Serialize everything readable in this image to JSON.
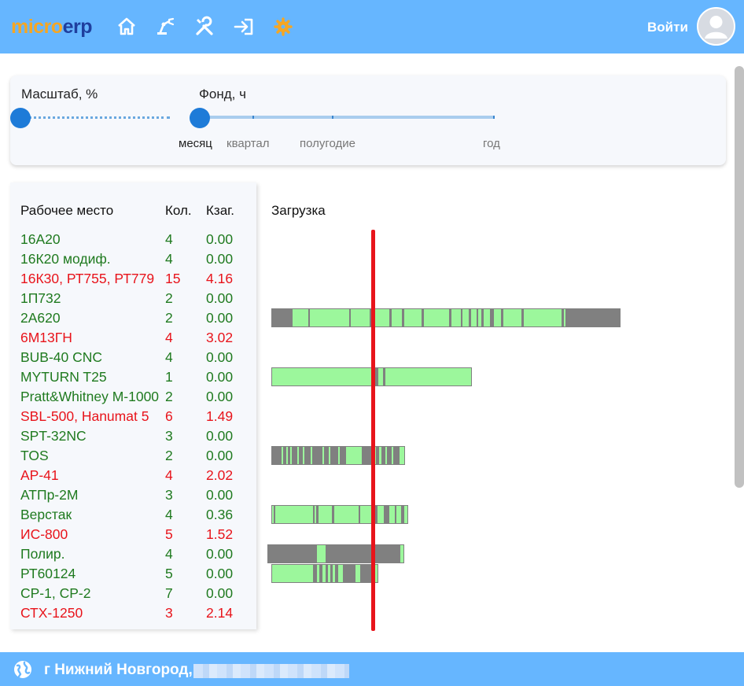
{
  "header": {
    "logo_part1": "micro",
    "logo_part2": "erp",
    "login_label": "Войти",
    "colors": {
      "bar": "#66b6ff",
      "logo1": "#f5a623",
      "logo2": "#1f3f9e"
    }
  },
  "settings": {
    "scale_label": "Масштаб, %",
    "fund_label": "Фонд, ч",
    "fund_ticks": [
      "месяц",
      "квартал",
      "полугодие",
      "год"
    ],
    "fund_selected": "месяц"
  },
  "table": {
    "headers": {
      "workplace": "Рабочее место",
      "qty": "Кол.",
      "coef": "Кзаг."
    },
    "rows": [
      {
        "name": "16А20",
        "qty": "4",
        "coef": "0.00",
        "status": "ok"
      },
      {
        "name": "16К20 модиф.",
        "qty": "4",
        "coef": "0.00",
        "status": "ok"
      },
      {
        "name": "16К30, РТ755, РТ779",
        "qty": "15",
        "coef": "4.16",
        "status": "over"
      },
      {
        "name": "1П732",
        "qty": "2",
        "coef": "0.00",
        "status": "ok"
      },
      {
        "name": "2А620",
        "qty": "2",
        "coef": "0.00",
        "status": "ok"
      },
      {
        "name": "6М13ГН",
        "qty": "4",
        "coef": "3.02",
        "status": "over"
      },
      {
        "name": "BUB-40 CNC",
        "qty": "4",
        "coef": "0.00",
        "status": "ok"
      },
      {
        "name": "MYTURN T25",
        "qty": "1",
        "coef": "0.00",
        "status": "ok"
      },
      {
        "name": "Pratt&Whitney M-1000",
        "qty": "2",
        "coef": "0.00",
        "status": "ok"
      },
      {
        "name": "SBL-500, Hanumat 5",
        "qty": "6",
        "coef": "1.49",
        "status": "over"
      },
      {
        "name": "SPT-32NC",
        "qty": "3",
        "coef": "0.00",
        "status": "ok"
      },
      {
        "name": "TOS",
        "qty": "2",
        "coef": "0.00",
        "status": "ok"
      },
      {
        "name": "АР-41",
        "qty": "4",
        "coef": "2.02",
        "status": "over"
      },
      {
        "name": "АТПр-2М",
        "qty": "3",
        "coef": "0.00",
        "status": "ok"
      },
      {
        "name": "Верстак",
        "qty": "4",
        "coef": "0.36",
        "status": "ok"
      },
      {
        "name": "ИС-800",
        "qty": "5",
        "coef": "1.52",
        "status": "over"
      },
      {
        "name": "Полир.",
        "qty": "4",
        "coef": "0.00",
        "status": "ok"
      },
      {
        "name": "РТ60124",
        "qty": "5",
        "coef": "0.00",
        "status": "ok"
      },
      {
        "name": "СР-1, СР-2",
        "qty": "7",
        "coef": "0.00",
        "status": "ok"
      },
      {
        "name": "СТХ-1250",
        "qty": "3",
        "coef": "2.14",
        "status": "over"
      }
    ]
  },
  "gantt": {
    "title": "Загрузка"
  },
  "footer": {
    "city": "г Нижний Новгород,"
  },
  "colors": {
    "ok": "#1f7a1f",
    "over": "#e8141b",
    "busy": "#9cf79c",
    "idle": "#808080",
    "now_line": "#e8141b"
  }
}
